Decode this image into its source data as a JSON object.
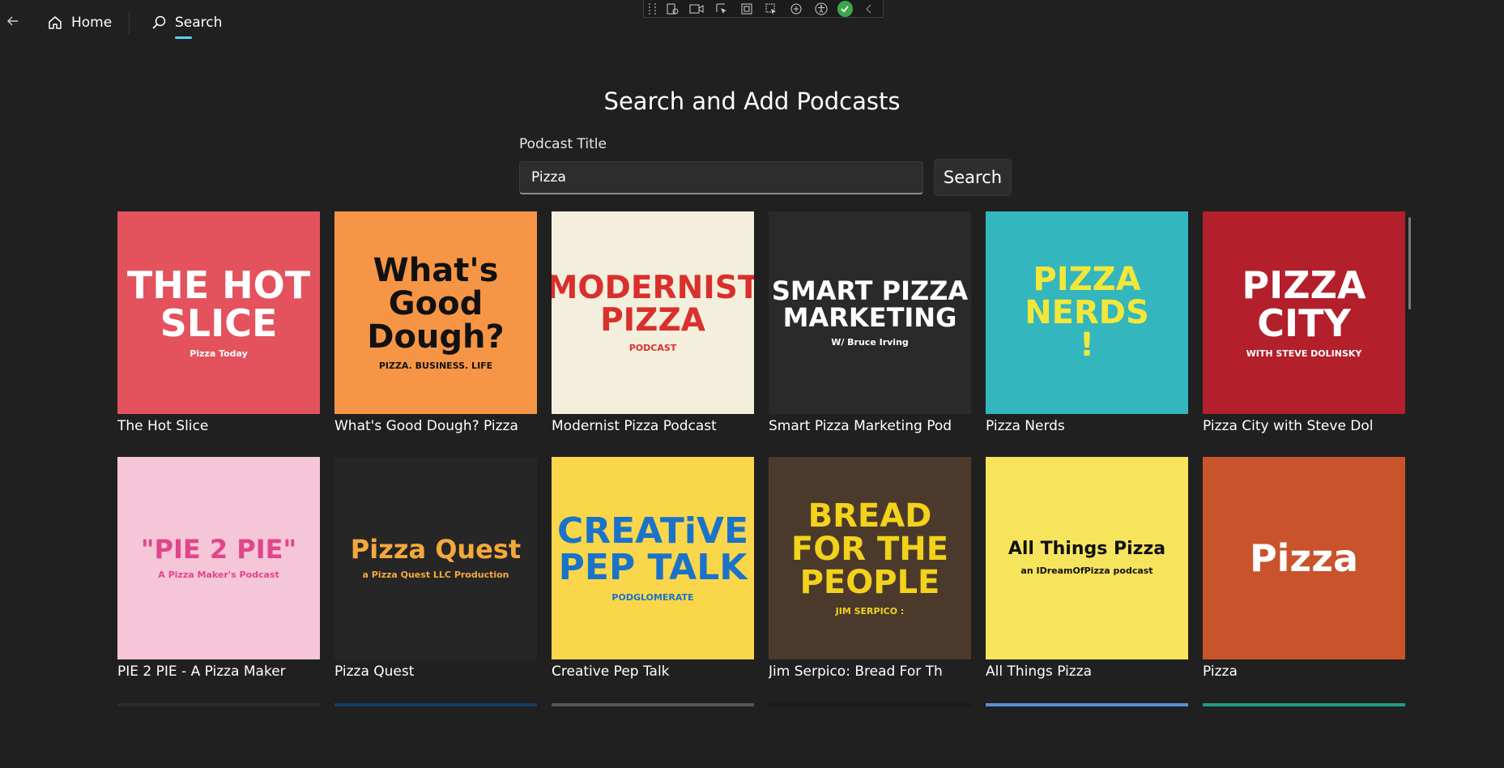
{
  "nav": {
    "home_label": "Home",
    "search_label": "Search",
    "accent": "#60cdff"
  },
  "page": {
    "title": "Search and Add Podcasts",
    "field_label": "Podcast Title",
    "search_value": "Pizza",
    "search_button": "Search"
  },
  "podcasts": [
    {
      "title": "The Hot Slice",
      "art": {
        "lines": [
          "THE HOT",
          "SLICE"
        ],
        "small": "Pizza Today",
        "bg": "#e4525e",
        "fg": "#ffffff"
      }
    },
    {
      "title": "What's Good Dough? Pizza",
      "art": {
        "lines": [
          "What's",
          "Good",
          "Dough?"
        ],
        "small": "PIZZA. BUSINESS. LIFE",
        "bg": "#f69545",
        "fg": "#111111"
      }
    },
    {
      "title": "Modernist Pizza Podcast",
      "art": {
        "lines": [
          "MODERNIST",
          "PIZZA"
        ],
        "small": "PODCAST",
        "bg": "#f4efdd",
        "fg": "#d8302c"
      }
    },
    {
      "title": "Smart Pizza Marketing Pod",
      "art": {
        "lines": [
          "SMART PIZZA",
          "MARKETING"
        ],
        "small": "W/ Bruce Irving",
        "bg": "#2a2a2a",
        "fg": "#ffffff"
      }
    },
    {
      "title": "Pizza Nerds",
      "art": {
        "lines": [
          "PIZZA",
          "NERDS",
          "!"
        ],
        "small": "",
        "bg": "#33b6be",
        "fg": "#f3e73a"
      }
    },
    {
      "title": "Pizza City with Steve Dol",
      "art": {
        "lines": [
          "PIZZA",
          "CITY"
        ],
        "small": "WITH STEVE DOLINSKY",
        "bg": "#b31f2b",
        "fg": "#ffffff"
      }
    },
    {
      "title": "PIE 2 PIE - A Pizza Maker",
      "art": {
        "lines": [
          "\"PIE 2 PIE\""
        ],
        "small": "A Pizza Maker's Podcast",
        "bg": "#f5c6d8",
        "fg": "#e1458a"
      }
    },
    {
      "title": "Pizza Quest",
      "art": {
        "lines": [
          "Pizza Quest"
        ],
        "small": "a Pizza Quest LLC Production",
        "bg": "#262626",
        "fg": "#f4a93b"
      }
    },
    {
      "title": "Creative Pep Talk",
      "art": {
        "lines": [
          "CREATiVE",
          "PEP TALK"
        ],
        "small": "PODGLOMERATE",
        "bg": "#f9d64a",
        "fg": "#1a73c9"
      }
    },
    {
      "title": "Jim Serpico: Bread For Th",
      "art": {
        "lines": [
          "BREAD",
          "FOR THE",
          "PEOPLE"
        ],
        "small": "JIM SERPICO :",
        "bg": "#4b3a2c",
        "fg": "#f2d21a"
      }
    },
    {
      "title": "All Things Pizza",
      "art": {
        "lines": [
          "All Things Pizza"
        ],
        "small": "an IDreamOfPizza podcast",
        "bg": "#f6e45c",
        "fg": "#111111"
      }
    },
    {
      "title": "Pizza",
      "art": {
        "lines": [
          "Pizza"
        ],
        "small": "",
        "bg": "#c9532b",
        "fg": "#ffffff"
      }
    }
  ],
  "partial_row_colors": [
    "#2b2b2b",
    "#163a6b",
    "#555555",
    "#1a1a1a",
    "#5b8fd6",
    "#1f9a8a"
  ]
}
